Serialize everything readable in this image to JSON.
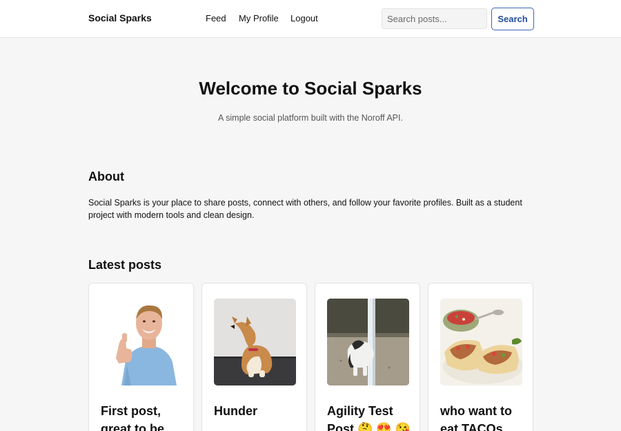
{
  "header": {
    "brand": "Social Sparks",
    "nav": [
      "Feed",
      "My Profile",
      "Logout"
    ],
    "search_placeholder": "Search posts...",
    "search_button": "Search"
  },
  "hero": {
    "title": "Welcome to Social Sparks",
    "subtitle": "A simple social platform built with the Noroff API."
  },
  "about": {
    "title": "About",
    "text": "Social Sparks is your place to share posts, connect with others, and follow your favorite profiles. Built as a student project with modern tools and clean design."
  },
  "latest": {
    "title": "Latest posts",
    "posts": [
      {
        "title": "First post, great to be",
        "image": "man-thumbs-up-photo"
      },
      {
        "title": "Hunder",
        "image": "corgi-dog-photo"
      },
      {
        "title": "Agility Test Post 🤔 😍 😘",
        "image": "agility-dog-photo"
      },
      {
        "title": "who want to eat TACOs",
        "image": "tacos-photo"
      }
    ]
  },
  "colors": {
    "accent": "#234e9c",
    "background": "#f6f6f6",
    "card_background": "#ffffff"
  }
}
